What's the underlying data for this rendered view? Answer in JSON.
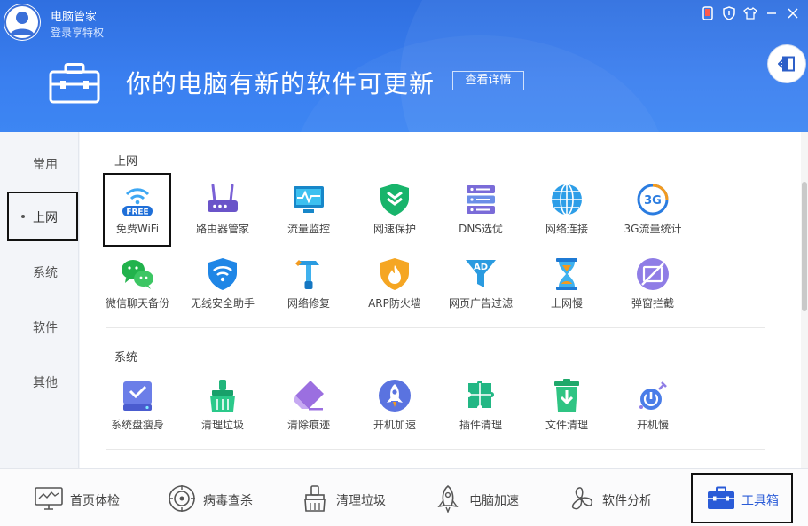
{
  "header": {
    "app_title": "电脑管家",
    "login_link": "登录享特权",
    "headline": "你的电脑有新的软件可更新",
    "detail_button": "查看详情"
  },
  "sidebar": {
    "items": [
      {
        "label": "常用"
      },
      {
        "label": "上网",
        "active": true
      },
      {
        "label": "系统"
      },
      {
        "label": "软件"
      },
      {
        "label": "其他"
      }
    ]
  },
  "sections": [
    {
      "title": "上网",
      "tools": [
        {
          "label": "免费WiFi",
          "icon": "free-wifi-icon",
          "badge": "FREE"
        },
        {
          "label": "路由器管家",
          "icon": "router-icon"
        },
        {
          "label": "流量监控",
          "icon": "traffic-monitor-icon"
        },
        {
          "label": "网速保护",
          "icon": "speed-shield-icon"
        },
        {
          "label": "DNS选优",
          "icon": "dns-server-icon"
        },
        {
          "label": "网络连接",
          "icon": "globe-icon"
        },
        {
          "label": "3G流量统计",
          "icon": "3g-icon",
          "badge": "3G"
        },
        {
          "label": "微信聊天备份",
          "icon": "wechat-icon"
        },
        {
          "label": "无线安全助手",
          "icon": "wifi-shield-icon"
        },
        {
          "label": "网络修复",
          "icon": "hammer-icon"
        },
        {
          "label": "ARP防火墙",
          "icon": "firewall-icon"
        },
        {
          "label": "网页广告过滤",
          "icon": "ad-filter-icon",
          "badge": "AD"
        },
        {
          "label": "上网慢",
          "icon": "hourglass-icon"
        },
        {
          "label": "弹窗拦截",
          "icon": "popup-block-icon"
        }
      ]
    },
    {
      "title": "系统",
      "tools": [
        {
          "label": "系统盘瘦身",
          "icon": "disk-slim-icon"
        },
        {
          "label": "清理垃圾",
          "icon": "broom-icon"
        },
        {
          "label": "清除痕迹",
          "icon": "eraser-icon"
        },
        {
          "label": "开机加速",
          "icon": "rocket-icon"
        },
        {
          "label": "插件清理",
          "icon": "puzzle-icon"
        },
        {
          "label": "文件清理",
          "icon": "trash-icon"
        },
        {
          "label": "开机慢",
          "icon": "power-slow-icon"
        }
      ]
    }
  ],
  "bottom_nav": [
    {
      "label": "首页体检",
      "icon": "monitor-icon"
    },
    {
      "label": "病毒查杀",
      "icon": "target-icon"
    },
    {
      "label": "清理垃圾",
      "icon": "brush-icon"
    },
    {
      "label": "电脑加速",
      "icon": "rocket-outline-icon"
    },
    {
      "label": "软件分析",
      "icon": "fan-icon"
    },
    {
      "label": "工具箱",
      "icon": "toolbox-icon",
      "active": true
    }
  ],
  "colors": {
    "header_blue": "#3a7ff0",
    "accent": "#2a5bd7"
  }
}
